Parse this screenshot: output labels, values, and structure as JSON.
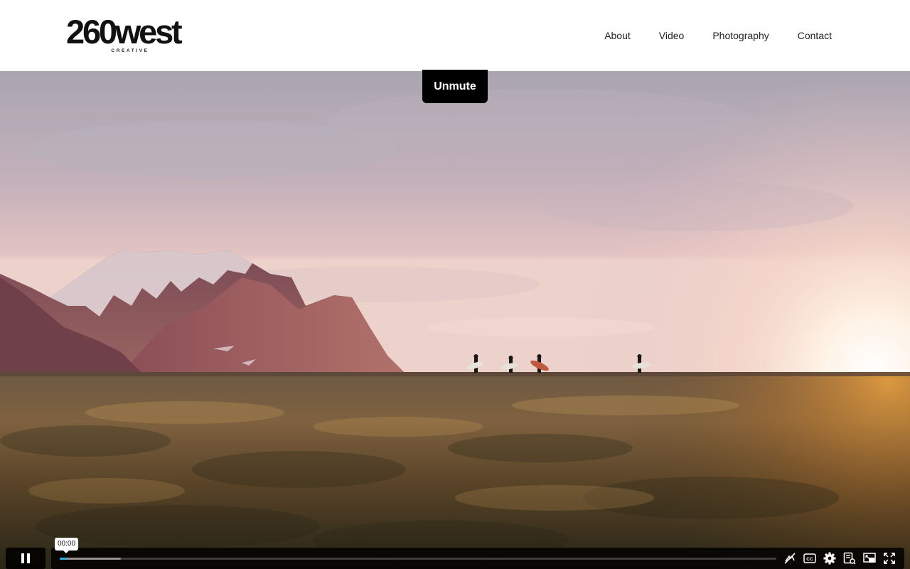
{
  "header": {
    "logo_text": "260west",
    "logo_subtext": "CREATIVE",
    "nav": [
      {
        "label": "About"
      },
      {
        "label": "Video"
      },
      {
        "label": "Photography"
      },
      {
        "label": "Contact"
      }
    ]
  },
  "video": {
    "unmute_label": "Unmute",
    "time_tooltip": "00:00",
    "progress_played_fraction": 0.0,
    "buffered_fraction": 0.085,
    "state": "playing",
    "icons": {
      "play_pause": "pause-icon",
      "controls_right": [
        "airplay-off-icon",
        "closed-captions-icon",
        "settings-icon",
        "transcript-icon",
        "picture-in-picture-icon",
        "fullscreen-icon"
      ]
    },
    "accent_color": "#2bb3e5"
  }
}
